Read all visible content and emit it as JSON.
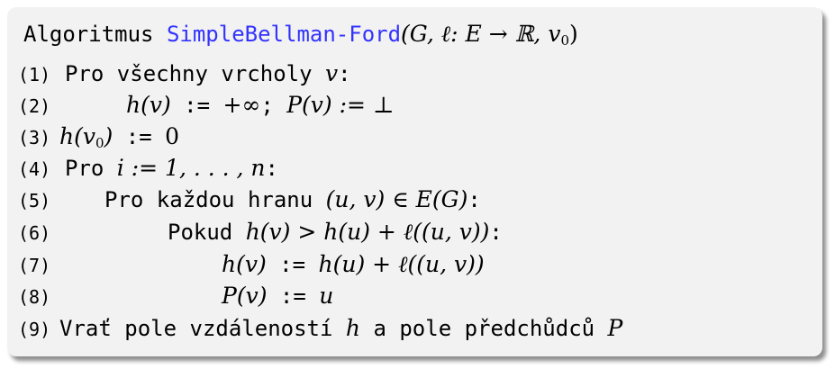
{
  "title": {
    "prefix": "Algoritmus ",
    "name": "SimpleBellman-Ford",
    "args": "(G, ℓ: E → ℝ, v",
    "args_sub": "0",
    "args_end": ")"
  },
  "lines": [
    {
      "num": "(1)",
      "text": "Pro všechny vrcholy ",
      "math": "v",
      "after": ":"
    },
    {
      "num": "(2)",
      "math1": "h(v)",
      "text1": " := ",
      "math2": "+∞",
      "text2": "; ",
      "math3": "P(v) := ⊥"
    },
    {
      "num": "(3)",
      "math1": "h(v",
      "sub": "0",
      "math1b": ")",
      "text1": " := ",
      "math2": "0"
    },
    {
      "num": "(4)",
      "text": "Pro ",
      "math": "i := 1, . . . , n",
      "after": ":"
    },
    {
      "num": "(5)",
      "text": "Pro každou hranu ",
      "math": "(u, v) ∈ E(G)",
      "after": ":"
    },
    {
      "num": "(6)",
      "text": "Pokud ",
      "math": "h(v) > h(u) + ℓ((u, v))",
      "after": ":"
    },
    {
      "num": "(7)",
      "math1": "h(v)",
      "text1": " := ",
      "math2": "h(u) + ℓ((u, v))"
    },
    {
      "num": "(8)",
      "math1": "P(v)",
      "text1": " := ",
      "math2": "u"
    },
    {
      "num": "(9)",
      "text": "Vrať pole vzdáleností ",
      "math": "h",
      "text2": " a pole předchůdců ",
      "math2": "P"
    }
  ]
}
